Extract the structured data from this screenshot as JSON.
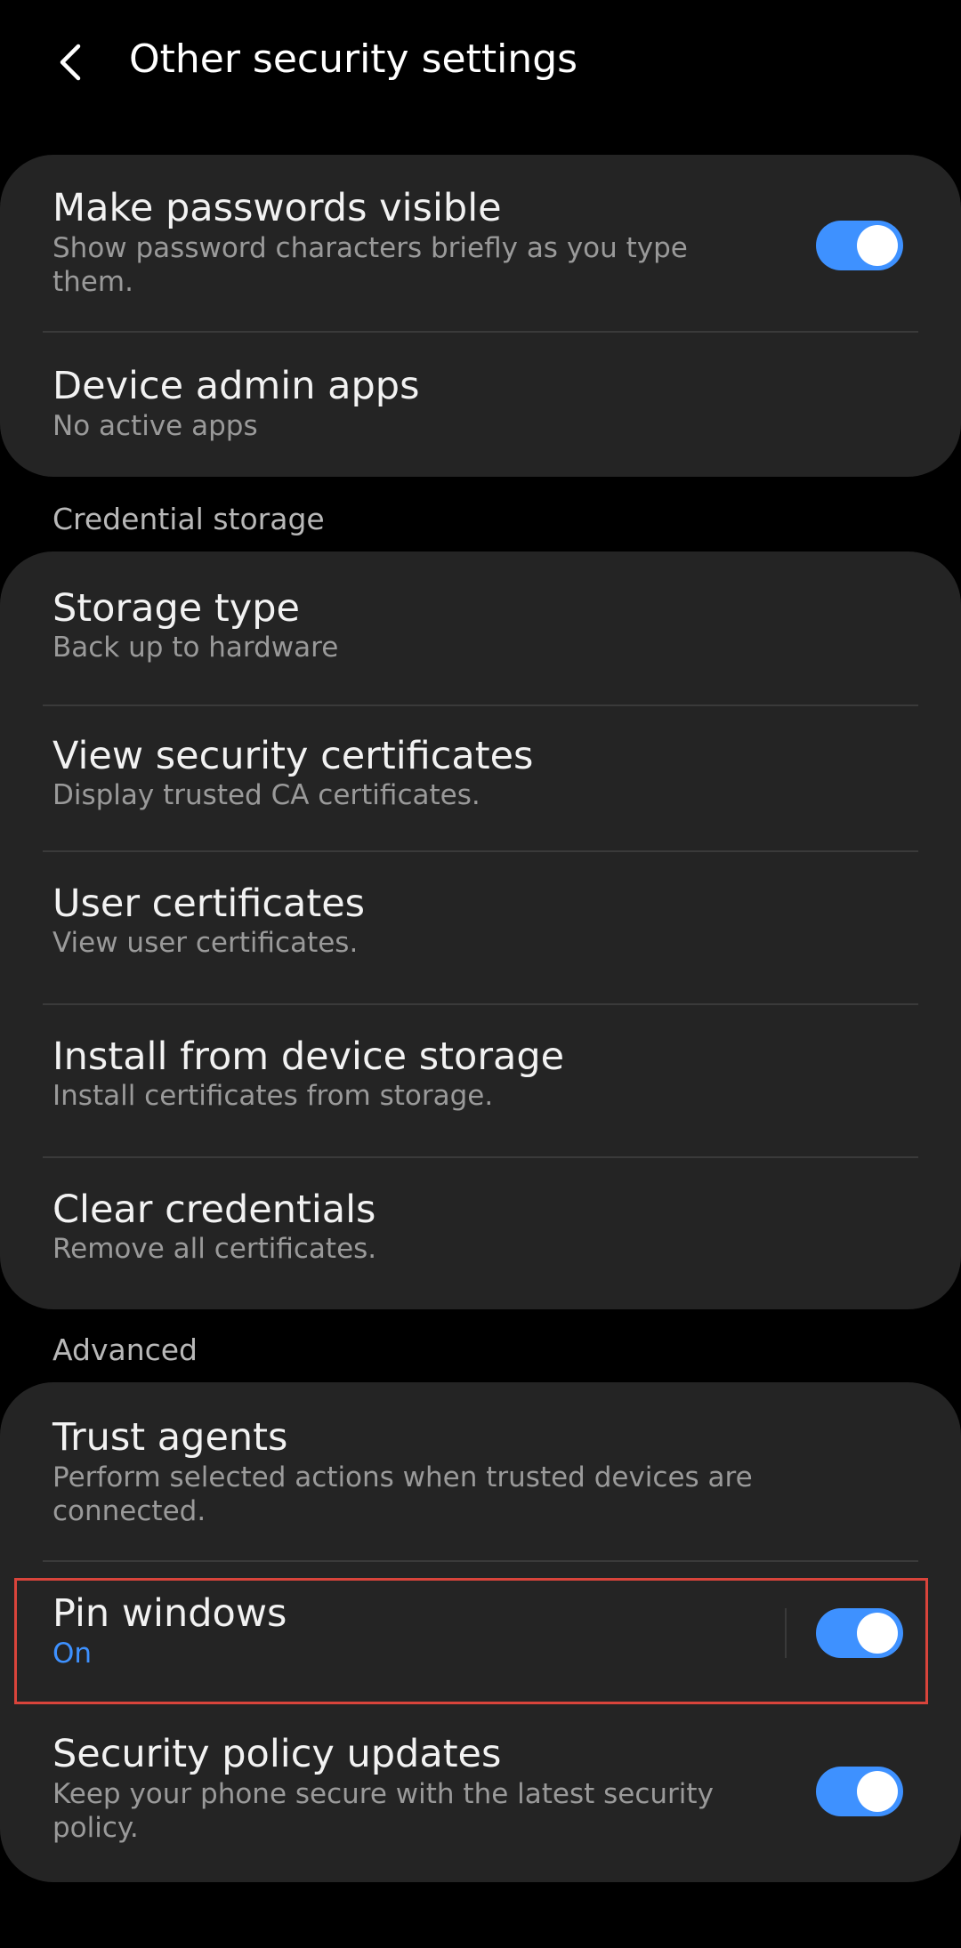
{
  "header": {
    "title": "Other security settings",
    "back_icon": "chevron-left-icon"
  },
  "cards": {
    "general": {
      "make_passwords_visible": {
        "title": "Make passwords visible",
        "subtitle": "Show password characters briefly as you type them.",
        "toggle_on": true
      },
      "device_admin_apps": {
        "title": "Device admin apps",
        "subtitle": "No active apps"
      }
    },
    "credential_storage": {
      "label": "Credential storage",
      "storage_type": {
        "title": "Storage type",
        "subtitle": "Back up to hardware"
      },
      "view_security_certificates": {
        "title": "View security certificates",
        "subtitle": "Display trusted CA certificates."
      },
      "user_certificates": {
        "title": "User certificates",
        "subtitle": "View user certificates."
      },
      "install_from_device_storage": {
        "title": "Install from device storage",
        "subtitle": "Install certificates from storage."
      },
      "clear_credentials": {
        "title": "Clear credentials",
        "subtitle": "Remove all certificates."
      }
    },
    "advanced": {
      "label": "Advanced",
      "trust_agents": {
        "title": "Trust agents",
        "subtitle": "Perform selected actions when trusted devices are connected."
      },
      "pin_windows": {
        "title": "Pin windows",
        "subtitle": "On",
        "toggle_on": true
      },
      "security_policy_updates": {
        "title": "Security policy updates",
        "subtitle": "Keep your phone secure with the latest security policy.",
        "toggle_on": true
      }
    }
  },
  "colors": {
    "accent": "#3e91ff",
    "card_bg": "#242424",
    "background": "#000000",
    "highlight_border": "#d9443b"
  }
}
